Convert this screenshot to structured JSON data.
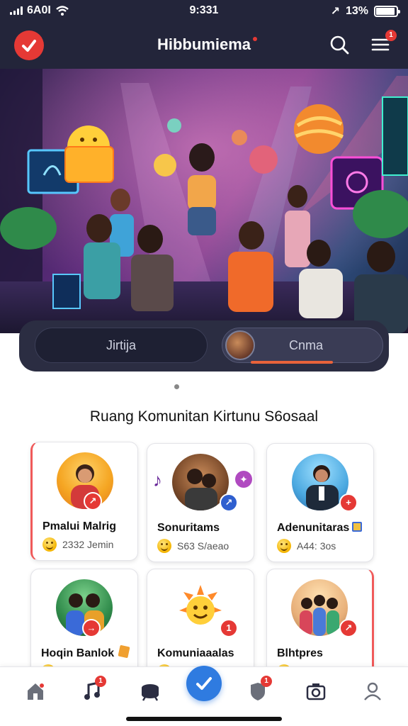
{
  "status_bar": {
    "carrier": "6A0I",
    "time": "9:331",
    "battery": "13%",
    "location_glyph": "↗"
  },
  "header": {
    "title": "Hibbumiema",
    "menu_badge": "1"
  },
  "toggle": {
    "left_label": "Jirtija",
    "right_label": "Cnma"
  },
  "section_title": "Ruang Komunitan Kirtunu S6osaal",
  "cards": [
    {
      "name": "Pmalui Malrig",
      "meta": "2332 Jemin",
      "badge": "↗",
      "badge_color": "#e53935"
    },
    {
      "name": "Sonuritams",
      "meta": "S63 S/aeao",
      "badge": "↗",
      "badge_color": "#2f5fcf"
    },
    {
      "name": "Adenunitaras",
      "meta": "A44: 3os",
      "badge": "+",
      "badge_color": "#e53935"
    },
    {
      "name": "Hoqin Banlok",
      "meta": "",
      "badge": "→",
      "badge_color": "#e53935"
    },
    {
      "name": "Komuniaaalas",
      "meta": "",
      "badge": "1",
      "badge_color": "#e53935"
    },
    {
      "name": "Blhtpres",
      "meta": "",
      "badge": "↗",
      "badge_color": "#e53935"
    }
  ],
  "bottom_nav": {
    "music_badge": "1",
    "shield_badge": "1"
  },
  "colors": {
    "header_bg": "#23253a",
    "accent_red": "#e53935",
    "accent_blue": "#2f7be0"
  }
}
